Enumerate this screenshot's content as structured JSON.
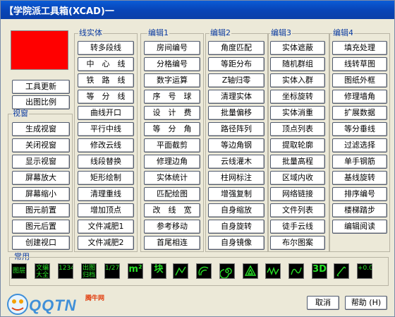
{
  "window": {
    "title": "【学院派工具箱(XCAD)一"
  },
  "color_swatch": {
    "color": "#ff0000"
  },
  "left_buttons": [
    "工具更新",
    "出图比例"
  ],
  "groups": {
    "view": {
      "label": "视窗",
      "buttons": [
        "生成视窗",
        "关闭视窗",
        "显示视窗",
        "屏幕放大",
        "屏幕缩小",
        "图元前置",
        "图元后置",
        "创建视口"
      ]
    },
    "line": {
      "label": "线实体",
      "buttons": [
        "转多段线",
        "中　心　线",
        "铁　路　线",
        "等　分　线",
        "曲线开口",
        "平行中线",
        "修改云线",
        "线段替换",
        "矩形绘制",
        "清理重线",
        "增加顶点",
        "文件减肥1",
        "文件减肥2"
      ]
    },
    "edit1": {
      "label": "编辑1",
      "buttons": [
        "房间编号",
        "分格编号",
        "数字运算",
        "序　号　球",
        "设　计　费",
        "等　分　角",
        "平面截剪",
        "修理边角",
        "实体统计",
        "匹配绘图",
        "改　线　宽",
        "参考移动",
        "首尾相连"
      ]
    },
    "edit2": {
      "label": "编辑2",
      "buttons": [
        "角度匹配",
        "等距分布",
        "Z轴归零",
        "清理实体",
        "批量偏移",
        "路径阵列",
        "等边角钢",
        "云线灌木",
        "柱网标注",
        "增强复制",
        "自身缩放",
        "自身旋转",
        "自身镜像"
      ]
    },
    "edit3": {
      "label": "编辑3",
      "buttons": [
        "实体遮蔽",
        "随机群组",
        "实体入群",
        "坐标旋转",
        "实体消重",
        "顶点列表",
        "提取轮廓",
        "批量高程",
        "区域内收",
        "网络链接",
        "文件列表",
        "徒手云线",
        "布尔图案"
      ]
    },
    "edit4": {
      "label": "编辑4",
      "buttons": [
        "填充处理",
        "线转草图",
        "图纸外框",
        "修理墙角",
        "扩展数据",
        "等分垂线",
        "过滤选择",
        "单手钢筋",
        "基线旋转",
        "排序编号",
        "楼梯踏步",
        "编辑阅读"
      ]
    }
  },
  "common": {
    "label": "常用",
    "icons": [
      {
        "name": "layer-icon",
        "text": "图层"
      },
      {
        "name": "library-icon",
        "text": "文编大全"
      },
      {
        "name": "number-icon",
        "text": "1234"
      },
      {
        "name": "print-icon",
        "text": "出图归档"
      },
      {
        "name": "area-calc-icon",
        "text": "1/27"
      },
      {
        "name": "square-meter-icon",
        "text": "m²"
      },
      {
        "name": "block-icon",
        "text": "块"
      },
      {
        "name": "draw-icon",
        "text": ""
      },
      {
        "name": "arc-icon",
        "text": ""
      },
      {
        "name": "spiral-icon",
        "text": ""
      },
      {
        "name": "triangle-icon",
        "text": ""
      },
      {
        "name": "wave-icon",
        "text": ""
      },
      {
        "name": "curve-icon",
        "text": ""
      },
      {
        "name": "3d-icon",
        "text": "3D"
      },
      {
        "name": "pen-icon",
        "text": ""
      },
      {
        "name": "elevation-icon",
        "text": "+0.00"
      }
    ]
  },
  "footer": {
    "cancel": "取消",
    "help": "帮助 (H)"
  },
  "watermark": {
    "brand": "QQTN",
    "tag": "腾牛网"
  }
}
